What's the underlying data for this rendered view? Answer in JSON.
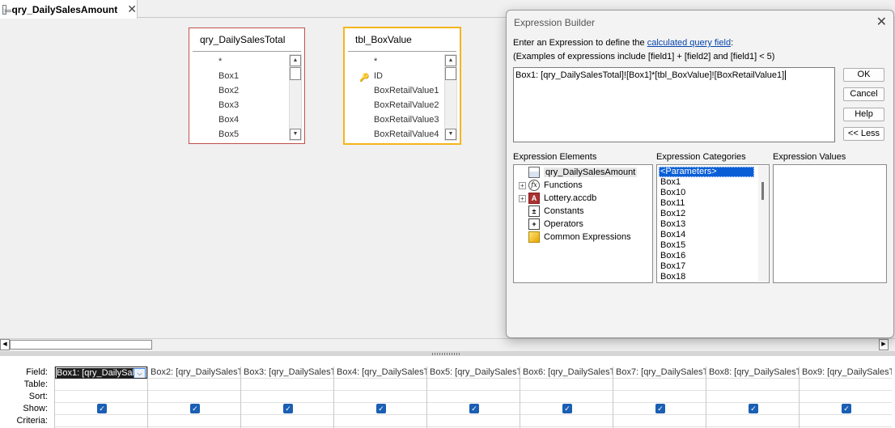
{
  "tab": {
    "title": "qry_DailySalesAmount",
    "close": "✕"
  },
  "tables": [
    {
      "title": "qry_DailySalesTotal",
      "fields": [
        "*",
        "Box1",
        "Box2",
        "Box3",
        "Box4",
        "Box5"
      ]
    },
    {
      "title": "tbl_BoxValue",
      "fields": [
        "*",
        "ID",
        "BoxRetailValue1",
        "BoxRetailValue2",
        "BoxRetailValue3",
        "BoxRetailValue4"
      ]
    }
  ],
  "grid": {
    "row_labels": [
      "Field:",
      "Table:",
      "Sort:",
      "Show:",
      "Criteria:"
    ],
    "fields": [
      "Box1: [qry_DailySal",
      "Box2: [qry_DailySalesT",
      "Box3: [qry_DailySalesT",
      "Box4: [qry_DailySalesT",
      "Box5: [qry_DailySalesT",
      "Box6: [qry_DailySalesT",
      "Box7: [qry_DailySalesT",
      "Box8: [qry_DailySalesT",
      "Box9: [qry_DailySalesT"
    ]
  },
  "dialog": {
    "title": "Expression Builder",
    "close": "✕",
    "instr_prefix": "Enter an Expression to define the ",
    "instr_link": "calculated query field",
    "instr_suffix": ":",
    "examples": "(Examples of expressions include [field1] + [field2] and [field1] < 5)",
    "expression": "Box1: [qry_DailySalesTotal]![Box1]*[tbl_BoxValue]![BoxRetailValue1]",
    "buttons": {
      "ok": "OK",
      "cancel": "Cancel",
      "help": "Help",
      "less": "<< Less"
    },
    "elements_label": "Expression Elements",
    "categories_label": "Expression Categories",
    "values_label": "Expression Values",
    "elements": [
      {
        "label": "qry_DailySalesAmount",
        "icon": "query-icon",
        "expander": ""
      },
      {
        "label": "Functions",
        "icon": "function-icon",
        "expander": "+"
      },
      {
        "label": "Lottery.accdb",
        "icon": "database-icon",
        "expander": "+"
      },
      {
        "label": "Constants",
        "icon": "constants-icon",
        "expander": ""
      },
      {
        "label": "Operators",
        "icon": "operators-icon",
        "expander": ""
      },
      {
        "label": "Common Expressions",
        "icon": "common-expressions-icon",
        "expander": ""
      }
    ],
    "categories": [
      "<Parameters>",
      "Box1",
      "Box10",
      "Box11",
      "Box12",
      "Box13",
      "Box14",
      "Box15",
      "Box16",
      "Box17",
      "Box18"
    ]
  }
}
